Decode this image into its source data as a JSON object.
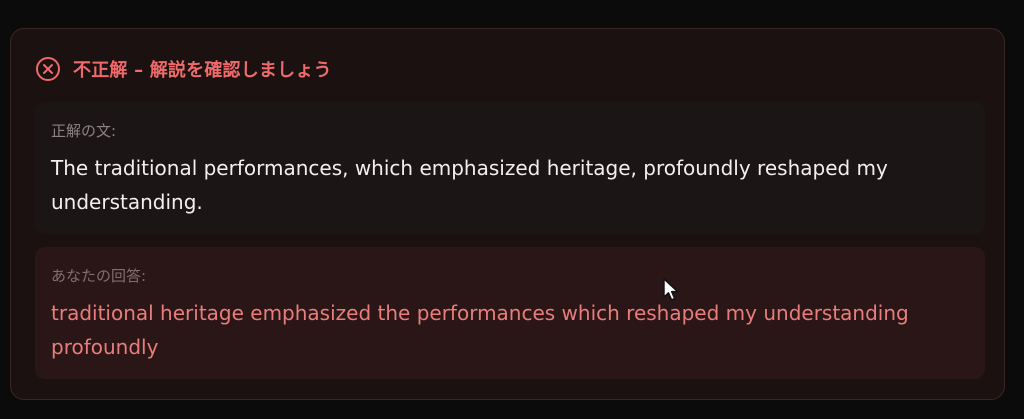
{
  "feedback": {
    "status_icon": "x-circle-icon",
    "title": "不正解 – 解説を確認しましょう",
    "accent_color": "#ef6a6a",
    "correct": {
      "label": "正解の文:",
      "text": "The traditional performances, which emphasized heritage, profoundly reshaped my understanding."
    },
    "answer": {
      "label": "あなたの回答:",
      "text": "traditional heritage emphasized the performances which reshaped my understanding profoundly",
      "color": "#e97d7d"
    }
  },
  "pointer": {
    "icon": "mouse-pointer-icon"
  }
}
